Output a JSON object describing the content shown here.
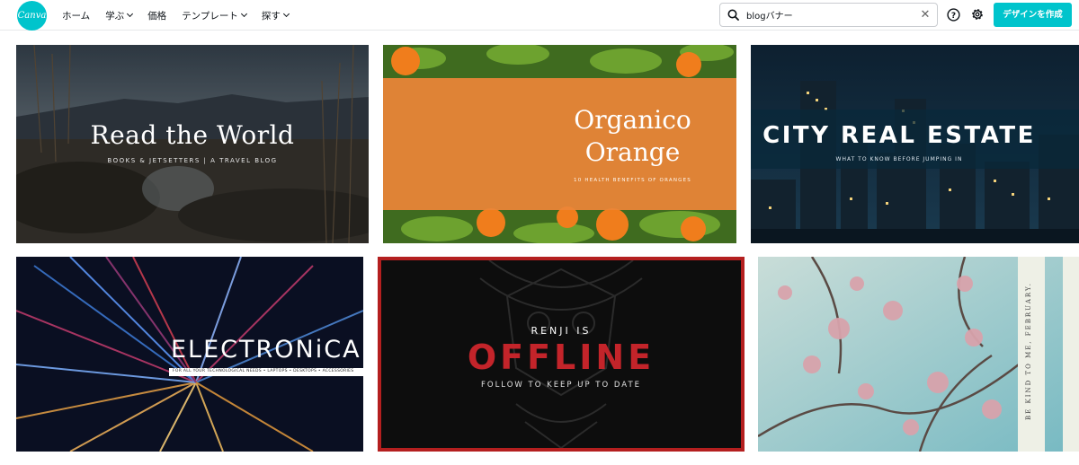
{
  "app": {
    "logo_text": "Canva",
    "brand_color": "#00c4cc"
  },
  "nav": [
    {
      "label": "ホーム",
      "has_menu": false
    },
    {
      "label": "学ぶ",
      "has_menu": true
    },
    {
      "label": "価格",
      "has_menu": false
    },
    {
      "label": "テンプレート",
      "has_menu": true
    },
    {
      "label": "探す",
      "has_menu": true
    }
  ],
  "search": {
    "value": "blogバナー",
    "icon": "search-icon",
    "clear_icon": "close-icon"
  },
  "header_icons": [
    "help-icon",
    "gear-icon"
  ],
  "create_button": {
    "label": "デザインを作成"
  },
  "templates": [
    {
      "title": "Read the World",
      "subtitle": "BOOKS & JETSETTERS | A TRAVEL BLOG"
    },
    {
      "title_line1": "Organico",
      "title_line2": "Orange",
      "subtitle": "10 HEALTH BENEFITS OF ORANGES"
    },
    {
      "title": "CITY REAL ESTATE",
      "subtitle": "WHAT TO KNOW BEFORE JUMPING IN"
    },
    {
      "title": "ELECTRONiCA",
      "subtitle": "FOR ALL YOUR TECHNOLOGICAL NEEDS • LAPTOPS • DESKTOPS • ACCESSORIES"
    },
    {
      "pre_title": "RENJI IS",
      "title": "OFFLINE",
      "subtitle": "FOLLOW TO KEEP UP TO DATE"
    },
    {
      "title": "BE KIND TO ME, FEBRUARY."
    }
  ]
}
